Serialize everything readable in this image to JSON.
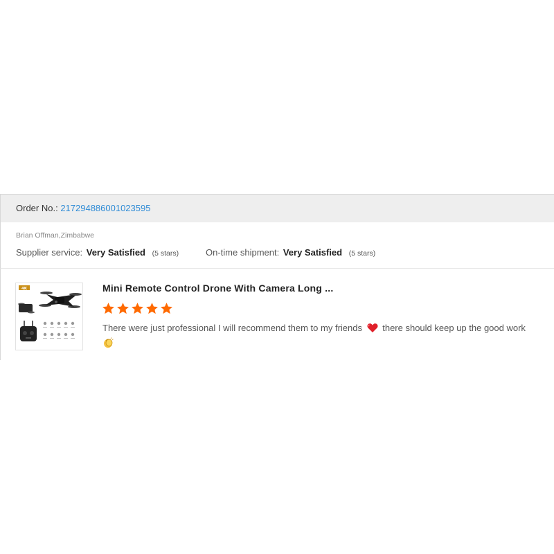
{
  "order": {
    "label": "Order No.:",
    "number": "217294886001023595"
  },
  "buyer": {
    "name_country": "Brian Offman,Zimbabwe"
  },
  "ratings": {
    "supplier": {
      "label": "Supplier service:",
      "value": "Very Satisfied",
      "stars_text": "(5 stars)"
    },
    "ontime": {
      "label": "On-time shipment:",
      "value": "Very Satisfied",
      "stars_text": "(5 stars)"
    }
  },
  "product": {
    "title": "Mini Remote Control Drone With Camera Long ...",
    "thumbnail_badge": "4K",
    "rating": 5,
    "rating_max": 5,
    "star_color": "#ff6a00"
  },
  "review": {
    "text_part1": "There were just professional I will recommend them to my friends",
    "text_part2": "there should keep up the good work",
    "emojis": [
      "heart-icon",
      "clapping-hands-icon"
    ]
  },
  "colors": {
    "link": "#2e8bd6",
    "header_bg": "#eeeeee",
    "accent_star": "#ff6a00"
  }
}
